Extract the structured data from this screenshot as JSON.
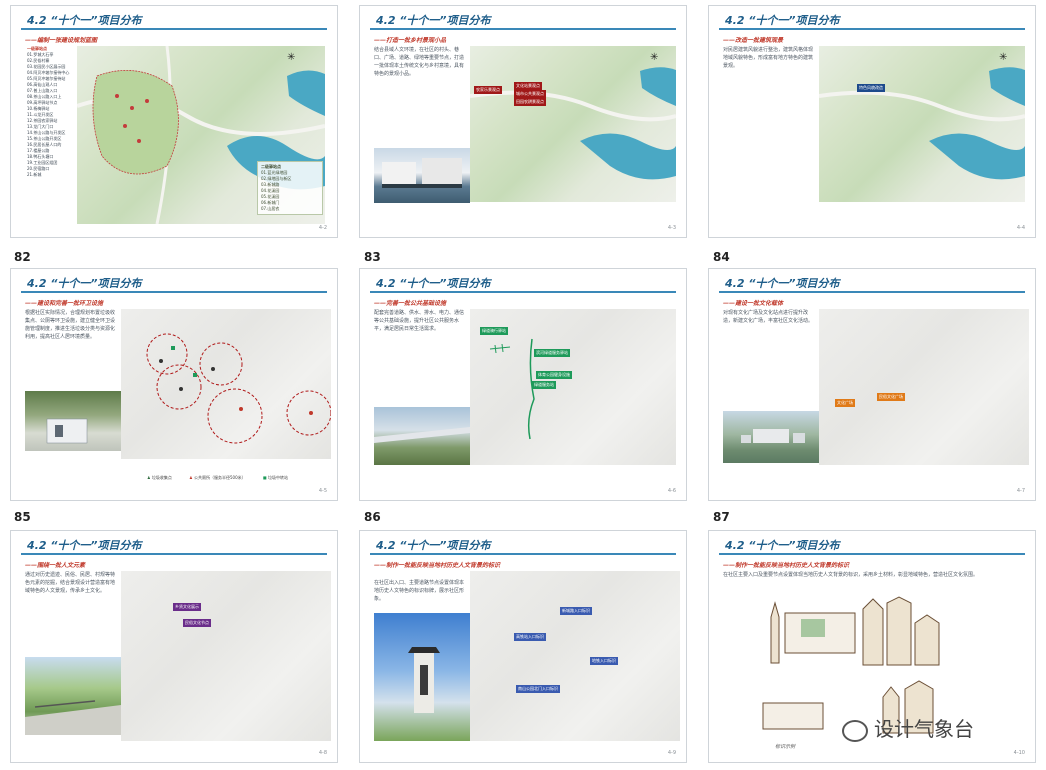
{
  "slide_title": "4.2 “十个一”项目分布",
  "slides": [
    {
      "num": "",
      "subtitle": "——编制一张建设规划蓝图",
      "text": "",
      "page": "4-2",
      "list_title": "一级驿站点",
      "list_items": [
        "01.罗城大石亭",
        "02.民俗村寨",
        "03.花园民小区展示园",
        "04.阿贝冲坡尔接待中心",
        "05.阿贝冲坡尔接待站",
        "06.高仙山观人口",
        "07.普上山路入口",
        "08.茶山公路入口上",
        "09.高坪驿站节点",
        "10.杨梅驿站",
        "11.斗龙开发区",
        "12.茶园农家驿站",
        "13.龙门大门口",
        "14.茶山公路与开发区",
        "15.茶山公路开发区",
        "16.民居长屋人口的",
        "17.楼屋公路",
        "18.鸭石头塘口",
        "19.工业园区组团",
        "20.民宿路口",
        "21.新城"
      ],
      "legend_title": "二级驿站点",
      "legend_items": [
        "01.蓝光绿地园",
        "02.绿地园与新区",
        "03.新城路",
        "04.花溪园",
        "05.花溪园",
        "06.新城门",
        "07.山居农"
      ]
    },
    {
      "num": "",
      "subtitle": "——打造一批乡村景观小品",
      "text": "结合县域人文环境，在社区的村头、巷口、广场、道路、绿地等重要节点，打造一批体现本土传统文化与乡村意境，具有特色的景观小品。",
      "page": "4-3",
      "tags": [
        "农家乐景观点",
        "文化站景观点",
        "城市公共景观点",
        "田园农耕景观点"
      ]
    },
    {
      "num": "",
      "subtitle": "——改造一批建筑观景",
      "text": "对民居建筑风貌进行整治，建筑风格体现地域风貌特色，形成富有地方特色的建筑景观。",
      "page": "4-4",
      "tags": [
        "特色风貌改造"
      ]
    },
    {
      "num": "82",
      "subtitle": "——建设和完善一批环卫设施",
      "text": "根据社区实际情况，合理规划布置垃圾收集点、公厕等环卫设施，建立健全环卫设施管理制度，推进生活垃圾分类与资源化利用，提高社区人居环境质量。",
      "page": "4-5",
      "legend": [
        "垃圾收集点",
        "公共厕所（服务半径500米）",
        "垃圾中转站"
      ]
    },
    {
      "num": "83",
      "subtitle": "——完善一批公共基础设施",
      "text": "配套完善道路、供水、排水、电力、通信等公共基础设施，提升社区公共服务水平，满足居民日常生活需求。",
      "page": "4-6",
      "tags": [
        "绿道骑行驿站",
        "滨河绿道服务驿站",
        "体育公园健身设施",
        "绿道服务站"
      ]
    },
    {
      "num": "84",
      "subtitle": "——建设一批文化载体",
      "text": "对现有文化广场及文化站点进行提升改造，新建文化广场，丰富社区文化活动。",
      "page": "4-7",
      "tags": [
        "文化广场",
        "民俗文化广场"
      ]
    },
    {
      "num": "85",
      "subtitle": "——围绕一批人文元素",
      "text": "通过对历史遗迹、民俗、民居、村规等特色元素的挖掘，结合景观设计营造富有地域特色的人文景观，传承乡土文化。",
      "page": "4-8",
      "tags": [
        "乡贤文化展示",
        "民俗文化节点"
      ]
    },
    {
      "num": "86",
      "subtitle": "——制作一批能反映当地村历史人文背景的标识",
      "text": "在社区出入口、主要道路节点设置体现本地历史人文特色的标识标牌，展示社区形象。",
      "page": "4-9",
      "tags": [
        "新城路入口标识",
        "高铁站入口标识",
        "地铁入口标识",
        "南山公园北门入口标识"
      ]
    },
    {
      "num": "87",
      "subtitle": "——制作一批能反映当地村历史人文背景的标识",
      "text": "在社区主要入口及重要节点设置体现当地历史人文背景的标识，采用乡土材料，彰显地域特色，营造社区文化氛围。",
      "page": "4-10",
      "caption": "标识示例"
    }
  ],
  "watermark": "设计气象台",
  "colors": {
    "title": "#1f5e8a",
    "rule": "#3a88b8",
    "subtitle": "#c0392b",
    "dark_red": "#a01818",
    "green": "#1e9a5a",
    "purple": "#6a2d8a",
    "blue_tag": "#3a5bb0",
    "orange": "#e07a18",
    "navy": "#1d4a8c"
  }
}
